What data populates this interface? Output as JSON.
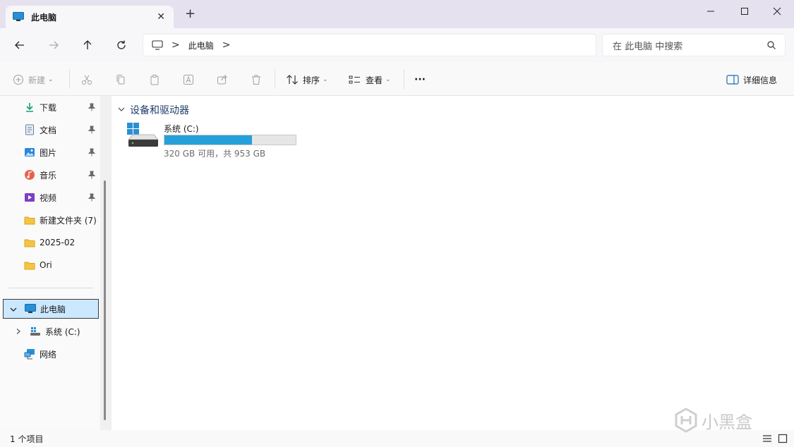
{
  "tab": {
    "title": "此电脑",
    "close": "✕"
  },
  "new_tab": "+",
  "window_controls": {
    "minimize": "—",
    "maximize": "□",
    "close": "✕"
  },
  "nav": {
    "back": "back-arrow-icon",
    "forward": "forward-arrow-icon",
    "up": "up-arrow-icon",
    "refresh": "refresh-icon"
  },
  "address": {
    "segments": [
      "此电脑"
    ],
    "separator": ">"
  },
  "search": {
    "placeholder": "在 此电脑 中搜索"
  },
  "commands": {
    "new_label": "新建",
    "sort_label": "排序",
    "view_label": "查看",
    "more": "···",
    "details_label": "详细信息"
  },
  "sidebar": {
    "quick_access": [
      {
        "label": "下载",
        "icon": "download-icon",
        "pinned": true
      },
      {
        "label": "文档",
        "icon": "documents-icon",
        "pinned": true
      },
      {
        "label": "图片",
        "icon": "pictures-icon",
        "pinned": true
      },
      {
        "label": "音乐",
        "icon": "music-icon",
        "pinned": true
      },
      {
        "label": "视频",
        "icon": "videos-icon",
        "pinned": true
      },
      {
        "label": "新建文件夹 (7)",
        "icon": "folder-icon",
        "pinned": false
      },
      {
        "label": "2025-02",
        "icon": "folder-icon",
        "pinned": false
      },
      {
        "label": "Ori",
        "icon": "folder-icon",
        "pinned": false
      }
    ],
    "tree": [
      {
        "label": "此电脑",
        "icon": "computer-icon",
        "expanded": true,
        "selected": true
      },
      {
        "label": "系统 (C:)",
        "icon": "drive-icon",
        "expanded": false
      },
      {
        "label": "网络",
        "icon": "network-icon"
      }
    ]
  },
  "main": {
    "group_title": "设备和驱动器",
    "drives": [
      {
        "name": "系统 (C:)",
        "info": "320 GB 可用，共 953 GB",
        "used_fraction": 0.664
      }
    ]
  },
  "status": {
    "item_count": "1 个项目"
  },
  "watermark": {
    "text": "小黑盒"
  },
  "colors": {
    "accent": "#26a0da",
    "selected_bg": "#cce8ff",
    "titlebar": "#e6e1ef"
  }
}
